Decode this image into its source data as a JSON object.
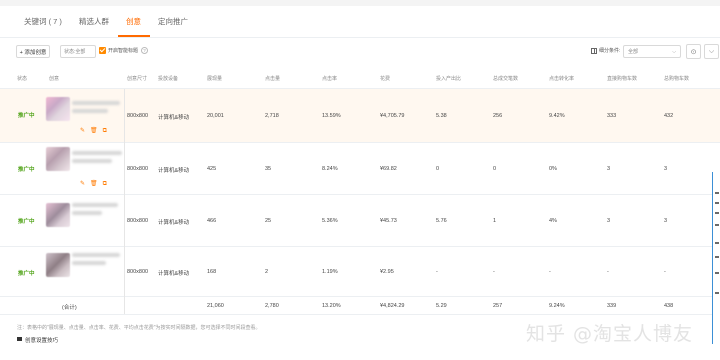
{
  "tabs": [
    {
      "label": "关键词 ( 7 )"
    },
    {
      "label": "精选人群"
    },
    {
      "label": "创意"
    },
    {
      "label": "定向推广"
    }
  ],
  "toolbar": {
    "add_label": "+ 添加创意",
    "status_select": "状态:全部",
    "smart_title_label": "开启智能标题",
    "split_label": "细分条件:",
    "split_value": "全部"
  },
  "table": {
    "headers": [
      "状态",
      "创意",
      "创意尺寸",
      "投放设备",
      "展现量",
      "点击量",
      "点击率",
      "花费",
      "投入产出比",
      "总成交笔数",
      "点击转化率",
      "直接购物车数",
      "总购物车数"
    ],
    "rows": [
      {
        "status": "推广中",
        "size": "800x800",
        "device": "计算机&移动",
        "impressions": "20,001",
        "clicks": "2,718",
        "ctr": "13.59%",
        "cost": "¥4,705.79",
        "roi": "5.38",
        "orders": "256",
        "cvr": "9.42%",
        "direct_cart": "333",
        "total_cart": "432"
      },
      {
        "status": "推广中",
        "size": "800x800",
        "device": "计算机&移动",
        "impressions": "425",
        "clicks": "35",
        "ctr": "8.24%",
        "cost": "¥69.82",
        "roi": "0",
        "orders": "0",
        "cvr": "0%",
        "direct_cart": "3",
        "total_cart": "3"
      },
      {
        "status": "推广中",
        "size": "800x800",
        "device": "计算机&移动",
        "impressions": "466",
        "clicks": "25",
        "ctr": "5.36%",
        "cost": "¥45.73",
        "roi": "5.76",
        "orders": "1",
        "cvr": "4%",
        "direct_cart": "3",
        "total_cart": "3"
      },
      {
        "status": "推广中",
        "size": "800x800",
        "device": "计算机&移动",
        "impressions": "168",
        "clicks": "2",
        "ctr": "1.19%",
        "cost": "¥2.95",
        "roi": "-",
        "orders": "-",
        "cvr": "-",
        "direct_cart": "-",
        "total_cart": "-"
      }
    ],
    "total": {
      "label": "(合计)",
      "impressions": "21,060",
      "clicks": "2,780",
      "ctr": "13.20%",
      "cost": "¥4,824.29",
      "roi": "5.29",
      "orders": "257",
      "cvr": "9.24%",
      "direct_cart": "339",
      "total_cart": "438"
    }
  },
  "footnote": "注：表格中的\"展现量、点击量、点击率、花费、平均点击花费\"为按实时间隔数据，您可选择不同时间段查看。",
  "tip": "创意设置技巧",
  "watermark": "知乎 @淘宝人博友",
  "colors": {
    "accent": "#ff6a00",
    "status_green": "#52a41a",
    "row_highlight": "#fff8f0"
  }
}
